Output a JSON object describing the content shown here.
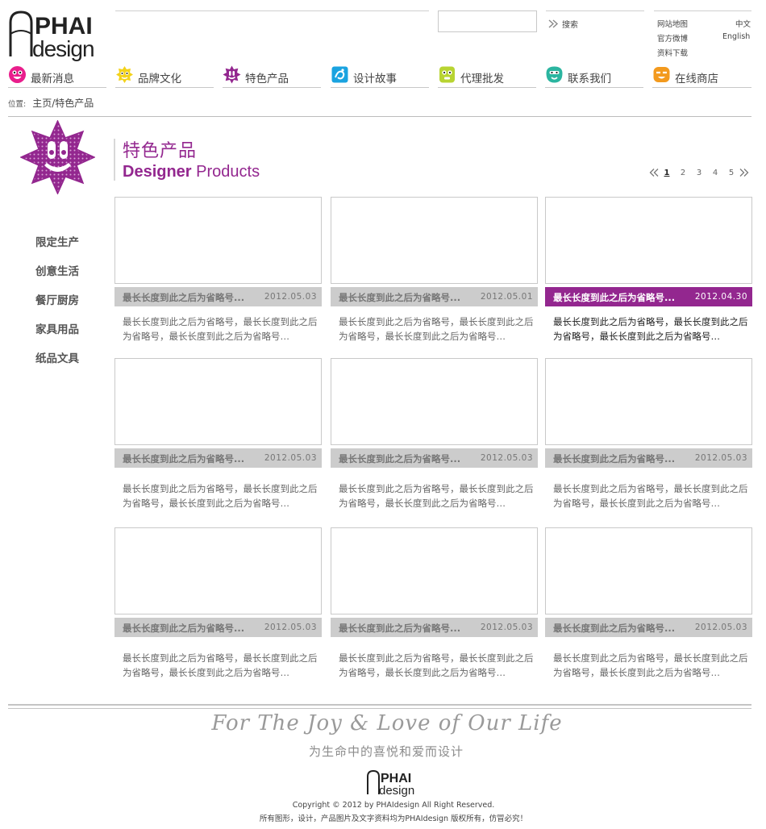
{
  "brand": {
    "logo_top": "PHAI",
    "logo_bottom": "design"
  },
  "header": {
    "search": {
      "placeholder": "",
      "value": "",
      "button_label": "搜索"
    },
    "utility": {
      "sitemap": "网站地图",
      "weibo": "官方微博",
      "downloads": "资料下载",
      "lang_cn": "中文",
      "lang_en": "English"
    }
  },
  "nav": {
    "items": [
      {
        "label": "最新消息",
        "icon": "pink-smiley-icon",
        "color": "#e91e8c"
      },
      {
        "label": "品牌文化",
        "icon": "yellow-face-icon",
        "color": "#f3d21a"
      },
      {
        "label": "特色产品",
        "icon": "purple-star-icon",
        "color": "#93278f"
      },
      {
        "label": "设计故事",
        "icon": "blue-doodle-icon",
        "color": "#1aa3e0"
      },
      {
        "label": "代理批发",
        "icon": "green-face-icon",
        "color": "#b8d432"
      },
      {
        "label": "联系我们",
        "icon": "teal-face-icon",
        "color": "#2bb5a0"
      },
      {
        "label": "在线商店",
        "icon": "orange-face-icon",
        "color": "#f39a1e"
      }
    ]
  },
  "breadcrumb": {
    "prefix": "位置:",
    "home": "主页",
    "separator": "/",
    "current": "特色产品"
  },
  "sidebar": {
    "badge_icon": "purple-star-badge-icon",
    "items": [
      {
        "label": "限定生产"
      },
      {
        "label": "创意生活"
      },
      {
        "label": "餐厅厨房"
      },
      {
        "label": "家具用品"
      },
      {
        "label": "纸品文具"
      }
    ]
  },
  "section": {
    "title_cn": "特色产品",
    "title_en_bold": "Designer",
    "title_en_light": "Products"
  },
  "pager": {
    "pages": [
      "1",
      "2",
      "3",
      "4",
      "5"
    ],
    "current": "1"
  },
  "products": [
    {
      "title": "最长长度到此之后为省略号...",
      "date": "2012.05.03",
      "desc": "最长长度到此之后为省略号，最长长度到此之后为省略号，最长长度到此之后为省略号…",
      "active": false
    },
    {
      "title": "最长长度到此之后为省略号...",
      "date": "2012.05.01",
      "desc": "最长长度到此之后为省略号，最长长度到此之后为省略号，最长长度到此之后为省略号…",
      "active": false
    },
    {
      "title": "最长长度到此之后为省略号...",
      "date": "2012.04.30",
      "desc": "最长长度到此之后为省略号，最长长度到此之后为省略号，最长长度到此之后为省略号…",
      "active": true
    },
    {
      "title": "最长长度到此之后为省略号...",
      "date": "2012.05.03",
      "desc": "最长长度到此之后为省略号，最长长度到此之后为省略号，最长长度到此之后为省略号…",
      "active": false
    },
    {
      "title": "最长长度到此之后为省略号...",
      "date": "2012.05.03",
      "desc": "最长长度到此之后为省略号，最长长度到此之后为省略号，最长长度到此之后为省略号…",
      "active": false
    },
    {
      "title": "最长长度到此之后为省略号...",
      "date": "2012.05.03",
      "desc": "最长长度到此之后为省略号，最长长度到此之后为省略号，最长长度到此之后为省略号…",
      "active": false
    },
    {
      "title": "最长长度到此之后为省略号...",
      "date": "2012.05.03",
      "desc": "最长长度到此之后为省略号，最长长度到此之后为省略号，最长长度到此之后为省略号…",
      "active": false
    },
    {
      "title": "最长长度到此之后为省略号...",
      "date": "2012.05.03",
      "desc": "最长长度到此之后为省略号，最长长度到此之后为省略号，最长长度到此之后为省略号…",
      "active": false
    },
    {
      "title": "最长长度到此之后为省略号...",
      "date": "2012.05.03",
      "desc": "最长长度到此之后为省略号，最长长度到此之后为省略号，最长长度到此之后为省略号…",
      "active": false
    }
  ],
  "footer": {
    "slogan_en": "For The Joy & Love of Our Life",
    "slogan_cn": "为生命中的喜悦和爱而设计",
    "copyright": "Copyright © 2012 by PHAIdesign All Right Reserved.",
    "rights": "所有图形，设计，产品图片及文字资料均为PHAIdesign  版权所有，仿冒必究！"
  },
  "colors": {
    "accent": "#93278f",
    "bar_gray": "#cccccc",
    "rule_gray": "#c8c8c8"
  }
}
